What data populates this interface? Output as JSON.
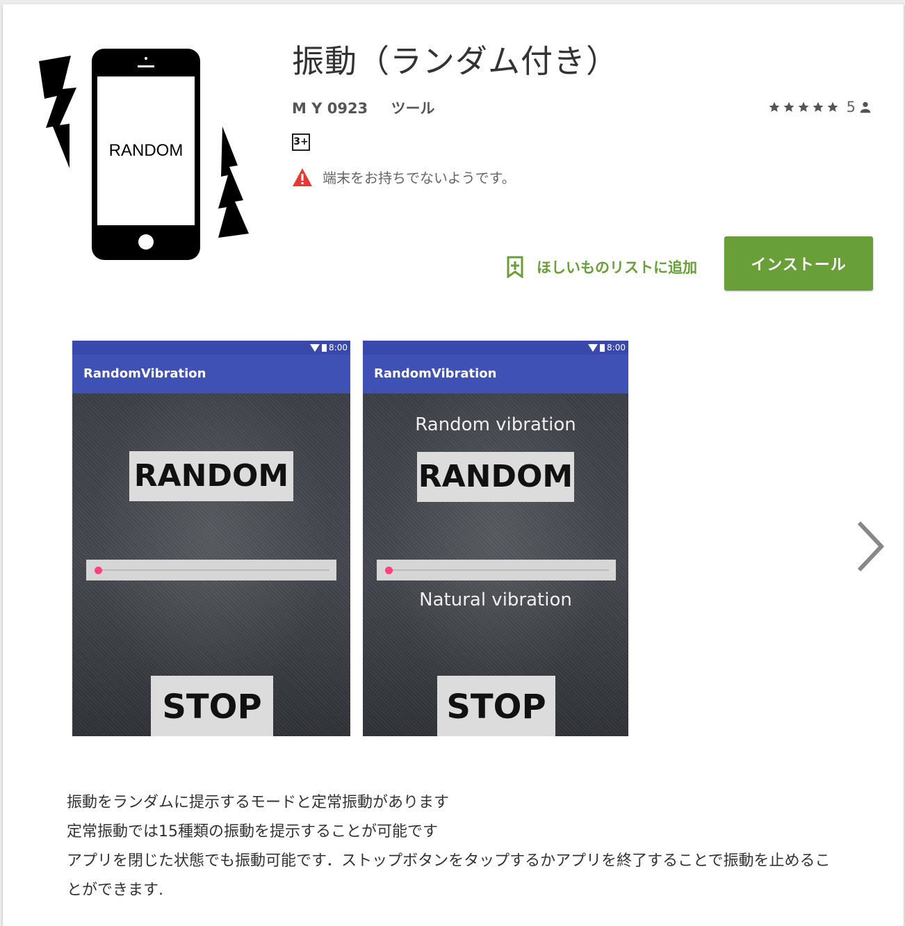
{
  "app": {
    "title": "振動（ランダム付き）",
    "developer": "M Y 0923",
    "category": "ツール",
    "rating_count": "5",
    "content_rating": "3+",
    "incompatible_warning": "端末をお持ちでないようです。",
    "icon_text": "RANDOM"
  },
  "actions": {
    "wishlist_label": "ほしいものリストに追加",
    "install_label": "インストール"
  },
  "screenshots": [
    {
      "status_time": "8:00",
      "app_bar_title": "RandomVibration",
      "random_button": "RANDOM",
      "stop_button": "STOP"
    },
    {
      "status_time": "8:00",
      "app_bar_title": "RandomVibration",
      "top_caption": "Random vibration",
      "random_button": "RANDOM",
      "middle_caption": "Natural vibration",
      "stop_button": "STOP"
    }
  ],
  "description": [
    "振動をランダムに提示するモードと定常振動があります",
    "定常振動では15種類の振動を提示することが可能です",
    "アプリを閉じた状態でも振動可能です．ストップボタンをタップするかアプリを終了することで振動を止めることができます."
  ],
  "colors": {
    "accent_green": "#689f38",
    "app_bar_blue": "#3f51b5",
    "slider_thumb": "#ff4081",
    "warning_red": "#e53935"
  }
}
